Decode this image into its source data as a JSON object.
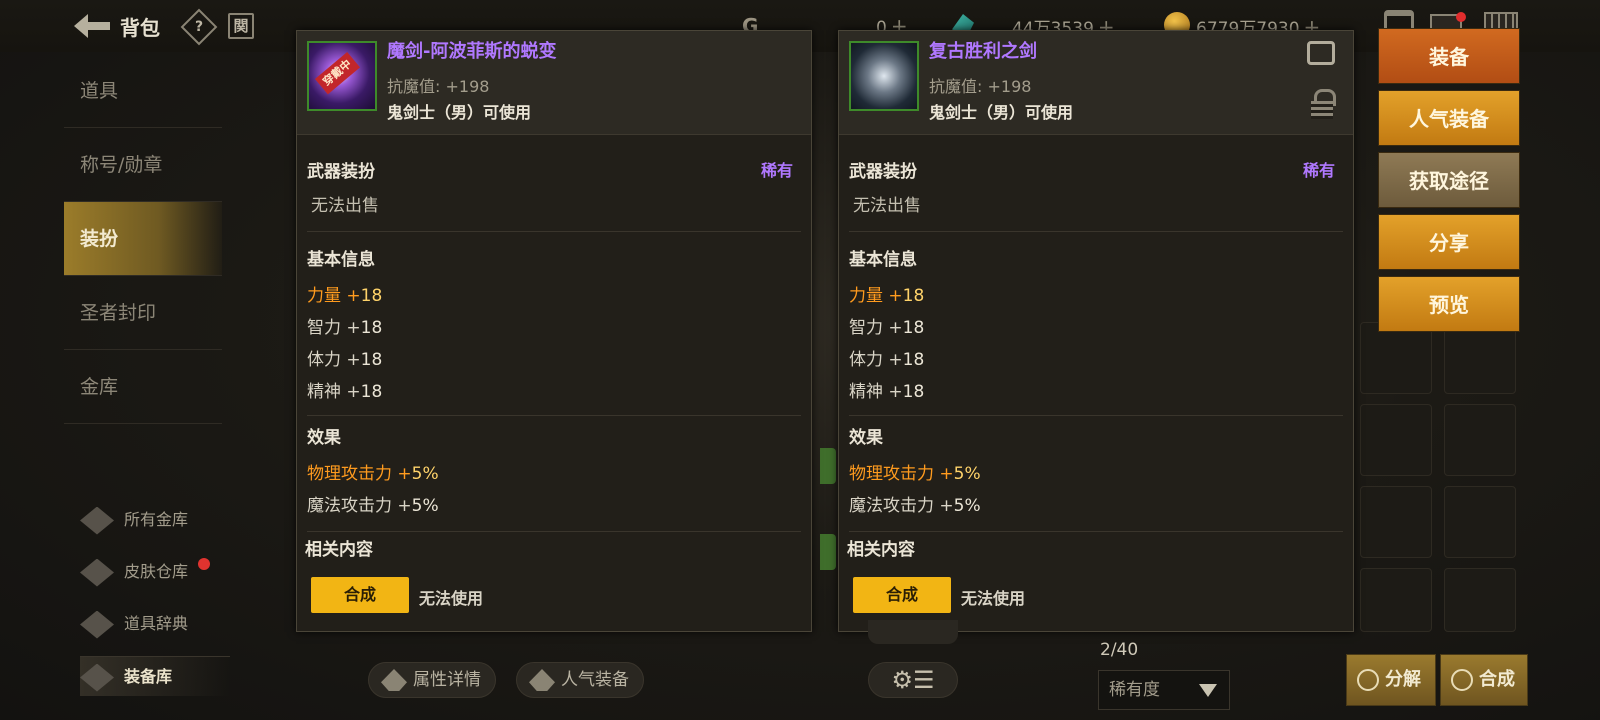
{
  "topbar": {
    "title": "背包",
    "help": "?",
    "calendar": "関",
    "cur1_symbol": "G",
    "currencies": [
      {
        "icon": "coin-c-icon",
        "value": "0"
      },
      {
        "icon": "crystal-icon",
        "value": "44万3539"
      },
      {
        "icon": "gold-coin-icon",
        "value": "6779万7930"
      }
    ]
  },
  "sidebar": {
    "items": [
      {
        "label": "道具"
      },
      {
        "label": "称号/勋章"
      },
      {
        "label": "装扮"
      },
      {
        "label": "圣者封印"
      },
      {
        "label": "金库"
      }
    ],
    "links": [
      {
        "label": "所有金库"
      },
      {
        "label": "皮肤仓库"
      },
      {
        "label": "道具辞典"
      },
      {
        "label": "装备库"
      }
    ]
  },
  "panels": [
    {
      "name": "魔剑-阿波菲斯的蜕变",
      "equipped_tag": "穿戴中",
      "resist": "抗魔值: +198",
      "class_req": "鬼剑士（男）可使用",
      "category": "武器装扮",
      "rarity": "稀有",
      "sell_note": "无法出售",
      "basic_title": "基本信息",
      "stats": [
        {
          "name": "力量 +",
          "value": "18"
        },
        {
          "name": "智力 +",
          "value": "18"
        },
        {
          "name": "体力 +",
          "value": "18"
        },
        {
          "name": "精神 +",
          "value": "18"
        }
      ],
      "effect_title": "效果",
      "effects": [
        {
          "name": "物理攻击力 +",
          "value": "5%"
        },
        {
          "name": "魔法攻击力 +",
          "value": "5%"
        }
      ],
      "related_title": "相关内容",
      "synth_label": "合成",
      "synth_note": "无法使用"
    },
    {
      "name": "复古胜利之剑",
      "resist": "抗魔值: +198",
      "class_req": "鬼剑士（男）可使用",
      "category": "武器装扮",
      "rarity": "稀有",
      "sell_note": "无法出售",
      "basic_title": "基本信息",
      "stats": [
        {
          "name": "力量 +",
          "value": "18"
        },
        {
          "name": "智力 +",
          "value": "18"
        },
        {
          "name": "体力 +",
          "value": "18"
        },
        {
          "name": "精神 +",
          "value": "18"
        }
      ],
      "effect_title": "效果",
      "effects": [
        {
          "name": "物理攻击力 +",
          "value": "5%"
        },
        {
          "name": "魔法攻击力 +",
          "value": "5%"
        }
      ],
      "related_title": "相关内容",
      "synth_label": "合成",
      "synth_note": "无法使用"
    }
  ],
  "actions": [
    {
      "label": "装备"
    },
    {
      "label": "人气装备"
    },
    {
      "label": "获取途径"
    },
    {
      "label": "分享"
    },
    {
      "label": "预览"
    }
  ],
  "bottom": {
    "attr_detail": "属性详情",
    "popular_equip": "人气装备",
    "settings_glyph": "⚙☰",
    "count": "2/40",
    "sort_value": "稀有度",
    "decompose": "分解",
    "compose": "合成"
  },
  "colors": {
    "rare": "#b078ff",
    "highlight": "#ff9b1e",
    "primary_action": "#d16a20",
    "gold_action": "#e3a12a",
    "synth": "#f2b514"
  }
}
